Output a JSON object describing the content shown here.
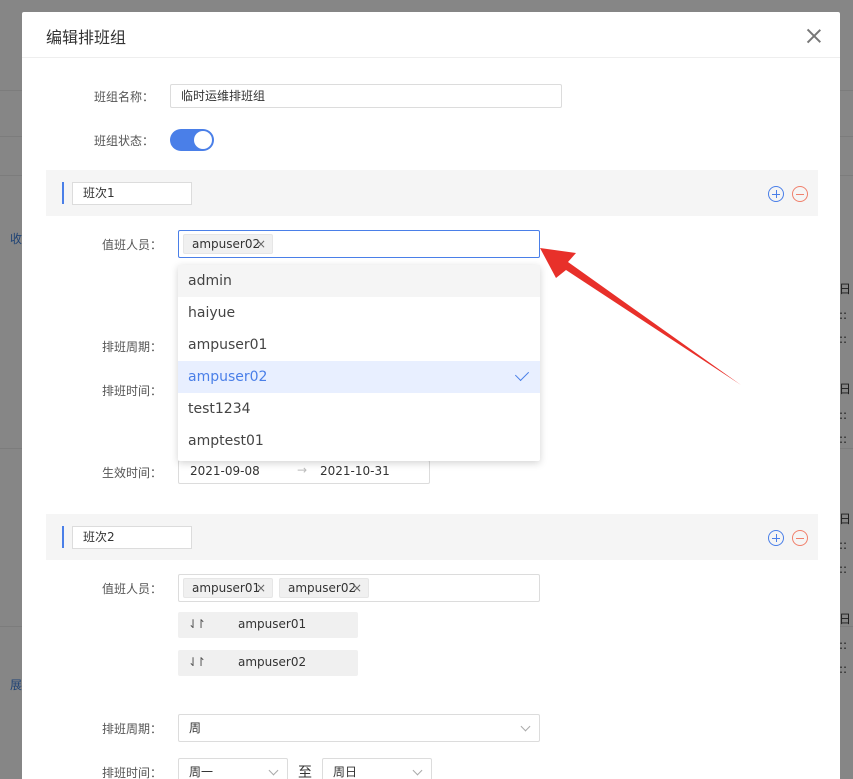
{
  "dialog": {
    "title": "编辑排班组"
  },
  "form": {
    "group_name_label": "班组名称：",
    "group_name_value": "临时运维排班组",
    "group_status_label": "班组状态："
  },
  "shift1": {
    "name": "班次1",
    "staff_label": "值班人员：",
    "staff_tags": [
      "ampuser02"
    ],
    "cycle_label": "排班周期：",
    "time_label": "排班时间：",
    "effective_label": "生效时间：",
    "date_start": "2021-09-08",
    "date_end": "2021-10-31",
    "date_arrow": "→",
    "dropdown_options": [
      {
        "label": "admin",
        "state": "hover"
      },
      {
        "label": "haiyue",
        "state": "normal"
      },
      {
        "label": "ampuser01",
        "state": "normal"
      },
      {
        "label": "ampuser02",
        "state": "selected"
      },
      {
        "label": "test1234",
        "state": "normal"
      },
      {
        "label": "amptest01",
        "state": "normal"
      }
    ]
  },
  "shift2": {
    "name": "班次2",
    "staff_label": "值班人员：",
    "staff_tags": [
      "ampuser01",
      "ampuser02"
    ],
    "order_items": [
      "ampuser01",
      "ampuser02"
    ],
    "sort_glyph": "⇃↾",
    "cycle_label": "排班周期：",
    "cycle_value": "周",
    "time_label": "排班时间：",
    "time_from": "周一",
    "time_to_word": "至",
    "time_to": "周日"
  },
  "background": {
    "left_text_1": "收",
    "left_text_2": "展",
    "right_fragments": [
      "日",
      "::",
      "::",
      "日",
      "::",
      "::",
      "日",
      "::",
      "::",
      "日",
      "::",
      "::"
    ]
  },
  "colors": {
    "accent": "#4a7fe8",
    "danger": "#f0806c",
    "arrow": "#e8302a"
  },
  "icons": {
    "close": "close-icon",
    "add": "plus-circle-icon",
    "remove": "minus-circle-icon",
    "check": "check-icon",
    "chevron": "chevron-down-icon",
    "sort": "sort-icon"
  }
}
